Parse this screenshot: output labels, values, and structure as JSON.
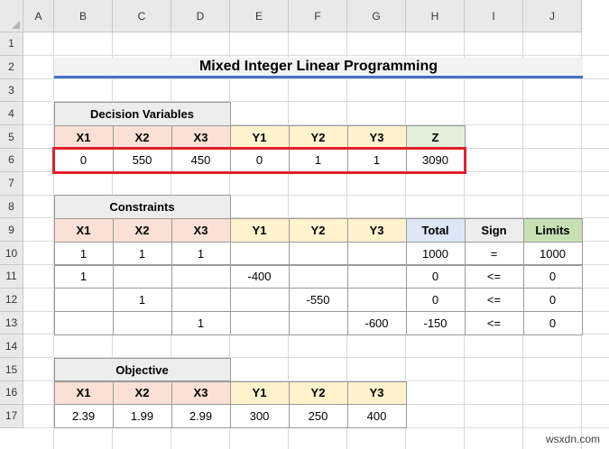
{
  "columns": [
    "A",
    "B",
    "C",
    "D",
    "E",
    "F",
    "G",
    "H",
    "I",
    "J"
  ],
  "rows": [
    "1",
    "2",
    "3",
    "4",
    "5",
    "6",
    "7",
    "8",
    "9",
    "10",
    "11",
    "12",
    "13",
    "14",
    "15",
    "16",
    "17"
  ],
  "title": "Mixed Integer Linear Programming",
  "decision": {
    "heading": "Decision Variables",
    "headers": [
      "X1",
      "X2",
      "X3",
      "Y1",
      "Y2",
      "Y3",
      "Z"
    ],
    "values": [
      "0",
      "550",
      "450",
      "0",
      "1",
      "1",
      "3090"
    ]
  },
  "constraints": {
    "heading": "Constraints",
    "headers": [
      "X1",
      "X2",
      "X3",
      "Y1",
      "Y2",
      "Y3",
      "Total",
      "Sign",
      "Limits"
    ],
    "rows": [
      [
        "1",
        "1",
        "1",
        "",
        "",
        "",
        "1000",
        "=",
        "1000"
      ],
      [
        "1",
        "",
        "",
        "-400",
        "",
        "",
        "0",
        "<=",
        "0"
      ],
      [
        "",
        "1",
        "",
        "",
        "-550",
        "",
        "0",
        "<=",
        "0"
      ],
      [
        "",
        "",
        "1",
        "",
        "",
        "-600",
        "-150",
        "<=",
        "0"
      ]
    ]
  },
  "objective": {
    "heading": "Objective",
    "headers": [
      "X1",
      "X2",
      "X3",
      "Y1",
      "Y2",
      "Y3"
    ],
    "values": [
      "2.39",
      "1.99",
      "2.99",
      "300",
      "250",
      "400"
    ]
  },
  "watermark": "wsxdn.com",
  "colors": {
    "pink": "#fbe0d5",
    "yellow": "#fff2cc",
    "green": "#e2efda",
    "grey": "#ededed",
    "blue": "#dde6f4",
    "limits_green": "#c6e0b4",
    "highlight_red": "#e0202a",
    "title_underline": "#4472c4"
  }
}
